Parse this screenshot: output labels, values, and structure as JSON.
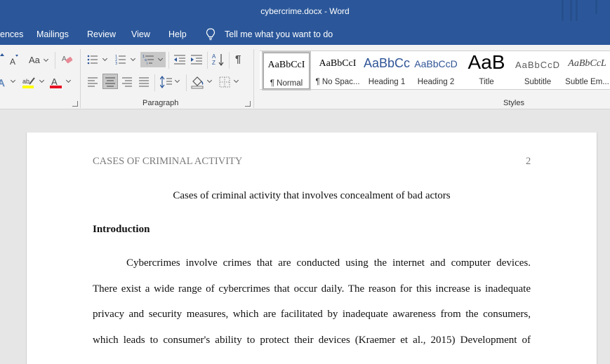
{
  "window": {
    "title": "cybercrime.docx  -  Word"
  },
  "menu": {
    "tabs": [
      "ences",
      "Mailings",
      "Review",
      "View",
      "Help"
    ],
    "tell_me": "Tell me what you want to do",
    "tell_me_icon": "lightbulb-icon"
  },
  "ribbon": {
    "font_group": {
      "icons": [
        "font-size-down-icon",
        "change-case-icon",
        "clear-formatting-icon",
        "text-effects-icon",
        "highlight-color-icon",
        "font-color-icon"
      ],
      "change_case_label": "Aa",
      "highlight_color": "#ffff00",
      "font_color": "#e81123"
    },
    "paragraph_group": {
      "label": "Paragraph",
      "icons": [
        "bullets-icon",
        "numbering-icon",
        "multilevel-list-icon",
        "decrease-indent-icon",
        "increase-indent-icon",
        "sort-icon",
        "show-hide-icon",
        "align-left-icon",
        "align-center-icon",
        "align-right-icon",
        "justify-icon",
        "line-spacing-icon",
        "shading-icon",
        "borders-icon"
      ],
      "active": [
        "multilevel-list",
        "align-center"
      ]
    },
    "styles_group": {
      "label": "Styles",
      "items": [
        {
          "sample": "AaBbCcI",
          "name": "¶ Normal",
          "selected": true
        },
        {
          "sample": "AaBbCcI",
          "name": "¶ No Spac..."
        },
        {
          "sample": "AaBbCc",
          "name": "Heading 1"
        },
        {
          "sample": "AaBbCcD",
          "name": "Heading 2"
        },
        {
          "sample": "AaB",
          "name": "Title"
        },
        {
          "sample": "AaBbCcD",
          "name": "Subtitle"
        },
        {
          "sample": "AaBbCcL",
          "name": "Subtle Em..."
        }
      ]
    }
  },
  "document": {
    "running_head": "CASES OF CRIMINAL ACTIVITY",
    "page_number": "2",
    "title": "Cases of criminal activity that involves concealment of bad actors",
    "heading": "Introduction",
    "lines": [
      "Cybercrimes involve crimes that are conducted using the internet and computer devices.",
      "There exist a wide range of cybercrimes that occur daily. The reason for this increase is inadequate",
      "privacy and security measures, which are facilitated by inadequate awareness from the consumers,",
      "which leads to consumer's ability to protect their devices (Kraemer et al., 2015)  Development of"
    ]
  },
  "colors": {
    "title_bar": "#2b579a",
    "ribbon_bg": "#f3f3f3",
    "canvas_bg": "#e6e6e6",
    "heading_blue": "#2f5496"
  }
}
